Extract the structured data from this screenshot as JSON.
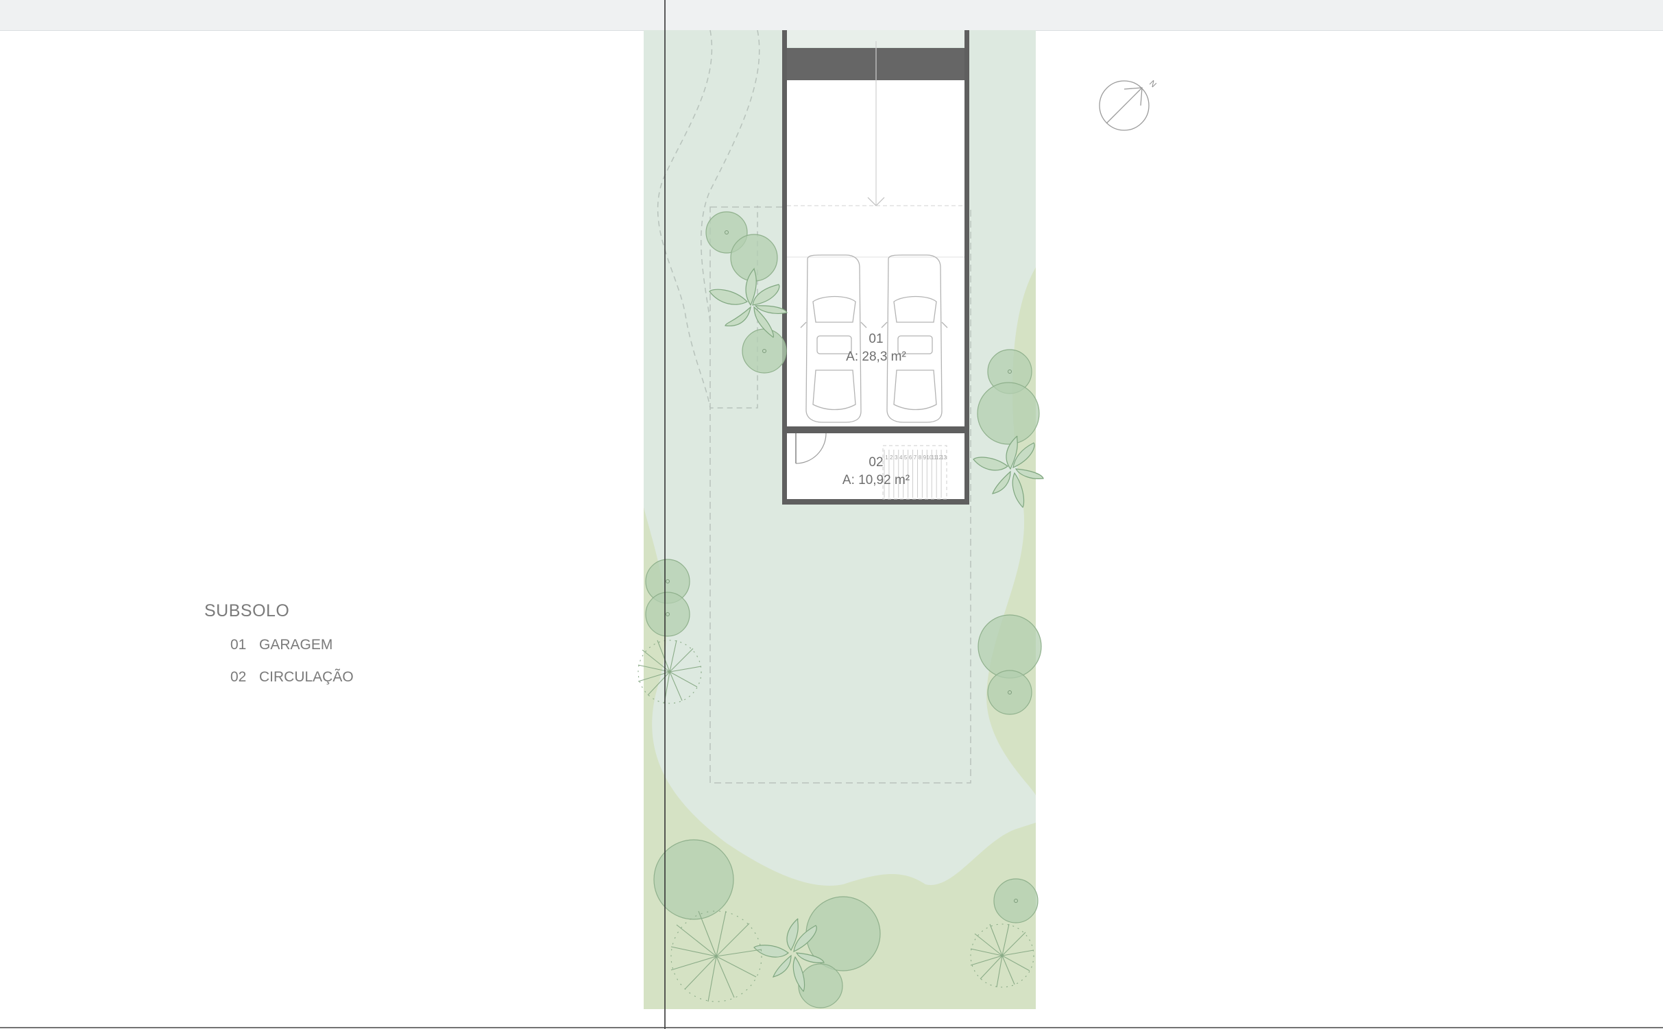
{
  "legend": {
    "title": "SUBSOLO",
    "items": [
      {
        "num": "01",
        "label": "GARAGEM"
      },
      {
        "num": "02",
        "label": "CIRCULAÇÃO"
      }
    ]
  },
  "rooms": [
    {
      "num": "01",
      "area": "A: 28,3 m²"
    },
    {
      "num": "02",
      "area": "A: 10,92 m²"
    }
  ],
  "compass": {
    "north_label": "N"
  },
  "stair_steps": [
    "1",
    "2",
    "3",
    "4",
    "5",
    "6",
    "7",
    "8",
    "9",
    "10",
    "11",
    "12",
    "13"
  ],
  "colors": {
    "lot_fill": "#dde9e0",
    "lawn_fill": "#d6e2c6",
    "wall": "#5f5f5f",
    "tree_fill": "#a9c9a6",
    "tree_stroke": "#7fa67f"
  }
}
